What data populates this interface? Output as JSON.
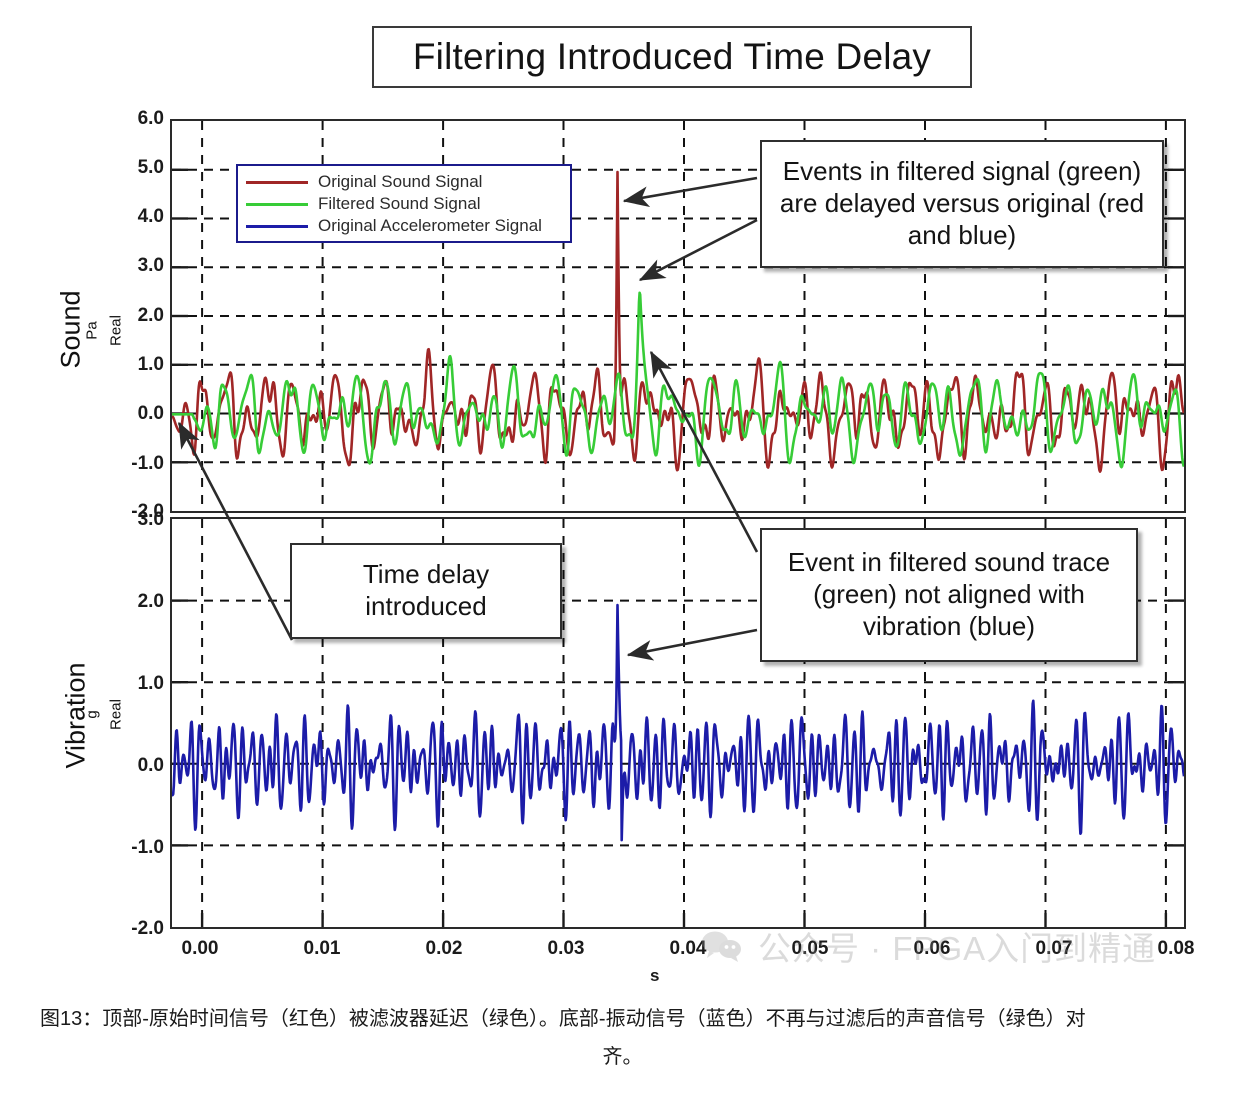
{
  "title": "Filtering Introduced Time Delay",
  "axes": {
    "top": {
      "name": "Sound",
      "unit": "Pa",
      "component": "Real",
      "yticks": [
        "6.0",
        "5.0",
        "4.0",
        "3.0",
        "2.0",
        "1.0",
        "0.0",
        "-1.0",
        "-2.0"
      ]
    },
    "bottom": {
      "name": "Vibration",
      "unit": "g",
      "component": "Real",
      "yticks": [
        "3.0",
        "2.0",
        "1.0",
        "0.0",
        "-1.0",
        "-2.0"
      ]
    },
    "x": {
      "unit": "s",
      "ticks": [
        "0.00",
        "0.01",
        "0.02",
        "0.03",
        "0.04",
        "0.05",
        "0.06",
        "0.07",
        "0.08"
      ]
    }
  },
  "legend": {
    "items": [
      {
        "label": "Original Sound Signal",
        "color": "#a02626"
      },
      {
        "label": "Filtered Sound Signal",
        "color": "#37cc37"
      },
      {
        "label": "Original Accelerometer Signal",
        "color": "#1c1ca8"
      }
    ]
  },
  "callouts": {
    "delay_vs_original": "Events in filtered signal (green) are delayed versus original (red and blue)",
    "time_delay": "Time delay introduced",
    "not_aligned": "Event in filtered sound trace (green) not aligned with vibration (blue)"
  },
  "watermark": {
    "text": "公众号 · FPGA入门到精通"
  },
  "caption": {
    "line1": "图13：顶部-原始时间信号（红色）被滤波器延迟（绿色）。底部-振动信号（蓝色）不再与过滤后的声音信号（绿色）对",
    "line2": "齐。"
  },
  "colors": {
    "red": "#a02626",
    "green": "#37cc37",
    "blue": "#1c1ca8",
    "grid": "#111111",
    "frame": "#2a2a2a",
    "legend_border": "#1b1b8c"
  },
  "chart_data": {
    "type": "line",
    "title": "Filtering Introduced Time Delay",
    "xlabel": "s",
    "xlim": [
      -0.0025,
      0.0815
    ],
    "xticks": [
      0.0,
      0.01,
      0.02,
      0.03,
      0.04,
      0.05,
      0.06,
      0.07,
      0.08
    ],
    "grid": true,
    "legend_position": "upper-left-inside",
    "panels": [
      {
        "name": "Sound",
        "ylabel": "Sound",
        "yunit": "Pa",
        "ycomponent": "Real",
        "ylim": [
          -2.0,
          6.0
        ],
        "yticks": [
          -2.0,
          -1.0,
          0.0,
          1.0,
          2.0,
          3.0,
          4.0,
          5.0,
          6.0
        ],
        "series": [
          {
            "name": "Original Sound Signal",
            "color": "#a02626",
            "noise_band": [
              -1.1,
              1.4
            ],
            "event": {
              "time": 0.0345,
              "peak": 5.25
            },
            "description": "Broadband sound pressure noise around 0 Pa with a sharp transient event spike to 5.25 Pa at t=0.0345 s"
          },
          {
            "name": "Filtered Sound Signal",
            "color": "#37cc37",
            "noise_band": [
              -1.1,
              1.4
            ],
            "event": {
              "time": 0.0363,
              "peak": 3.1
            },
            "delay_s": 0.0018,
            "description": "Low-pass filtered version of the sound signal; same noise envelope but phase-shifted later in time, event spike reduced to 3.1 Pa and delayed to t=0.0363 s"
          }
        ]
      },
      {
        "name": "Vibration",
        "ylabel": "Vibration",
        "yunit": "g",
        "ycomponent": "Real",
        "ylim": [
          -2.0,
          3.0
        ],
        "yticks": [
          -2.0,
          -1.0,
          0.0,
          1.0,
          2.0,
          3.0
        ],
        "series": [
          {
            "name": "Original Accelerometer Signal",
            "color": "#1c1ca8",
            "noise_band": [
              -0.75,
              0.9
            ],
            "event": {
              "time": 0.0345,
              "peak": 2.6,
              "trough": -1.55
            },
            "description": "Accelerometer vibration signal oscillating about 0 g with a sharp event at t=0.0345 s peaking at 2.6 g and undershooting to -1.55 g, time-aligned with the original sound event"
          }
        ]
      }
    ],
    "annotations": [
      {
        "text": "Events in filtered signal (green) are delayed versus original (red and blue)",
        "points_to": [
          {
            "panel": "Sound",
            "series": "Original Sound Signal",
            "x": 0.0345,
            "y": 4.55
          },
          {
            "panel": "Sound",
            "series": "Filtered Sound Signal",
            "x": 0.0363,
            "y": 2.85
          }
        ]
      },
      {
        "text": "Time delay introduced",
        "points_to": [
          {
            "panel": "Sound",
            "series": "Filtered Sound Signal",
            "x": 0.0002,
            "y": 0.0
          }
        ]
      },
      {
        "text": "Event in filtered sound trace (green) not aligned with vibration (blue)",
        "points_to": [
          {
            "panel": "Sound",
            "series": "Filtered Sound Signal",
            "x": 0.0365,
            "y": 1.45
          },
          {
            "panel": "Vibration",
            "series": "Original Accelerometer Signal",
            "x": 0.0348,
            "y": 1.55
          }
        ]
      }
    ]
  }
}
